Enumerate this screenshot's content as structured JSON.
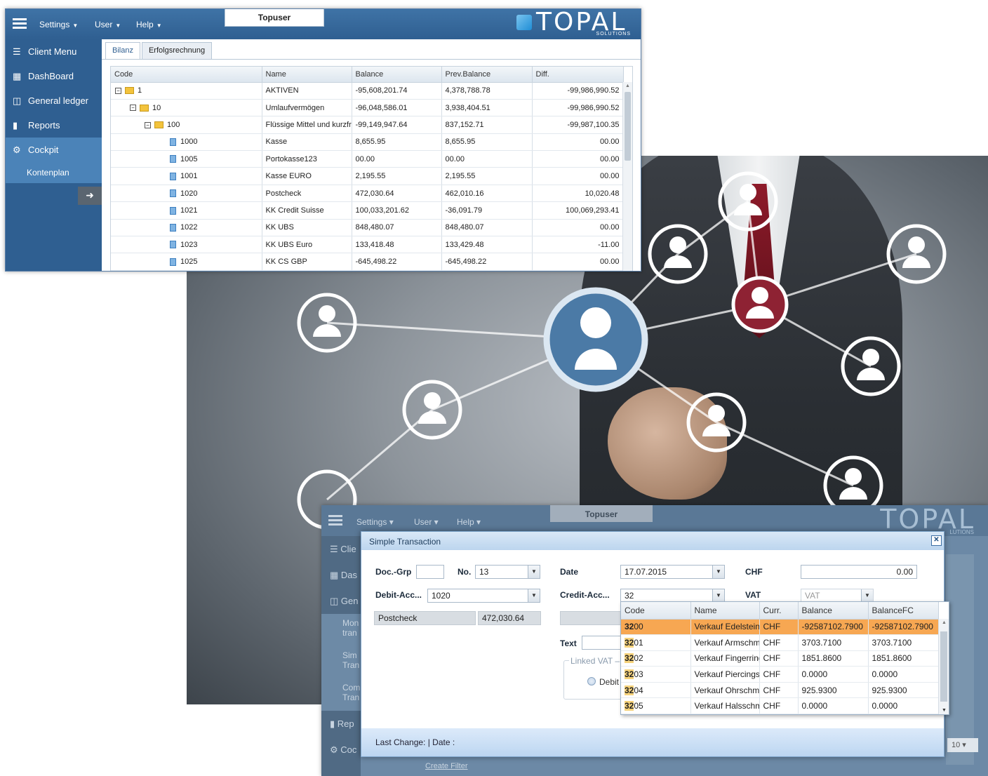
{
  "main_window": {
    "menu": [
      "Settings",
      "User",
      "Help"
    ],
    "user_title": "Topuser",
    "logo_text": "TOPAL",
    "logo_sub": "SOLUTIONS",
    "sidebar": {
      "items": [
        {
          "label": "Client Menu",
          "icon": "list-icon"
        },
        {
          "label": "DashBoard",
          "icon": "dashboard-icon"
        },
        {
          "label": "General ledger",
          "icon": "book-icon"
        },
        {
          "label": "Reports",
          "icon": "chart-icon"
        },
        {
          "label": "Cockpit",
          "icon": "gear-icon"
        }
      ],
      "sub_item": "Kontenplan"
    },
    "tabs": [
      "Bilanz",
      "Erfolgsrechnung"
    ],
    "grid": {
      "headers": [
        "Code",
        "Name",
        "Balance",
        "Prev.Balance",
        "Diff."
      ],
      "rows": [
        {
          "code": "1",
          "name": "AKTIVEN",
          "balance": "-95,608,201.74",
          "prev": "4,378,788.78",
          "diff": "-99,986,990.52"
        },
        {
          "code": "10",
          "name": "Umlaufvermögen",
          "balance": "-96,048,586.01",
          "prev": "3,938,404.51",
          "diff": "-99,986,990.52"
        },
        {
          "code": "100",
          "name": "Flüssige Mittel und kurzfr",
          "balance": "-99,149,947.64",
          "prev": "837,152.71",
          "diff": "-99,987,100.35"
        },
        {
          "code": "1000",
          "name": "Kasse",
          "balance": "8,655.95",
          "prev": "8,655.95",
          "diff": "00.00"
        },
        {
          "code": "1005",
          "name": "Portokasse123",
          "balance": "00.00",
          "prev": "00.00",
          "diff": "00.00"
        },
        {
          "code": "1001",
          "name": "Kasse EURO",
          "balance": "2,195.55",
          "prev": "2,195.55",
          "diff": "00.00"
        },
        {
          "code": "1020",
          "name": "Postcheck",
          "balance": "472,030.64",
          "prev": "462,010.16",
          "diff": "10,020.48"
        },
        {
          "code": "1021",
          "name": "KK Credit Suisse",
          "balance": "100,033,201.62",
          "prev": "-36,091.79",
          "diff": "100,069,293.41"
        },
        {
          "code": "1022",
          "name": "KK UBS",
          "balance": "848,480.07",
          "prev": "848,480.07",
          "diff": "00.00"
        },
        {
          "code": "1023",
          "name": "KK UBS Euro",
          "balance": "133,418.48",
          "prev": "133,429.48",
          "diff": "-11.00"
        },
        {
          "code": "1025",
          "name": "KK CS GBP",
          "balance": "-645,498.22",
          "prev": "-645,498.22",
          "diff": "00.00"
        }
      ]
    }
  },
  "second_window": {
    "menu": [
      "Settings",
      "User",
      "Help"
    ],
    "user_title": "Topuser",
    "logo_text": "TOPAL",
    "logo_sub": "LUTIONS",
    "sidebar": [
      "Clie",
      "Das",
      "Gen",
      "Rep",
      "Coc"
    ],
    "sub_items": [
      "Mon tran",
      "Sim Tran",
      "Com Tran"
    ],
    "create_filter": "Create Filter",
    "page_size": "10"
  },
  "dialog": {
    "title": "Simple Transaction",
    "doc_grp_label": "Doc.-Grp",
    "doc_grp_value": "",
    "no_label": "No.",
    "no_value": "13",
    "date_label": "Date",
    "date_value": "17.07.2015",
    "currency_label": "CHF",
    "amount_value": "0.00",
    "debit_label": "Debit-Acc...",
    "debit_value": "1020",
    "credit_label": "Credit-Acc...",
    "credit_value": "32",
    "vat_label": "VAT",
    "vat_placeholder": "VAT",
    "debit_name": "Postcheck",
    "debit_balance": "472,030.64",
    "text_label": "Text",
    "linked_vat_label": "Linked VAT",
    "debit_radio_label": "Debit",
    "footer": "Last Change: | Date :"
  },
  "account_dropdown": {
    "headers": [
      "Code",
      "Name",
      "Curr.",
      "Balance",
      "BalanceFC"
    ],
    "rows": [
      {
        "match": "32",
        "rest": "00",
        "name": "Verkauf Edelstein",
        "curr": "CHF",
        "balance": "-92587102.7900",
        "balance_fc": "-92587102.7900"
      },
      {
        "match": "32",
        "rest": "01",
        "name": "Verkauf Armschm",
        "curr": "CHF",
        "balance": "3703.7100",
        "balance_fc": "3703.7100"
      },
      {
        "match": "32",
        "rest": "02",
        "name": "Verkauf Fingerring",
        "curr": "CHF",
        "balance": "1851.8600",
        "balance_fc": "1851.8600"
      },
      {
        "match": "32",
        "rest": "03",
        "name": "Verkauf Piercings",
        "curr": "CHF",
        "balance": "0.0000",
        "balance_fc": "0.0000"
      },
      {
        "match": "32",
        "rest": "04",
        "name": "Verkauf Ohrschm",
        "curr": "CHF",
        "balance": "925.9300",
        "balance_fc": "925.9300"
      },
      {
        "match": "32",
        "rest": "05",
        "name": "Verkauf Halsschm",
        "curr": "CHF",
        "balance": "0.0000",
        "balance_fc": "0.0000"
      }
    ]
  }
}
